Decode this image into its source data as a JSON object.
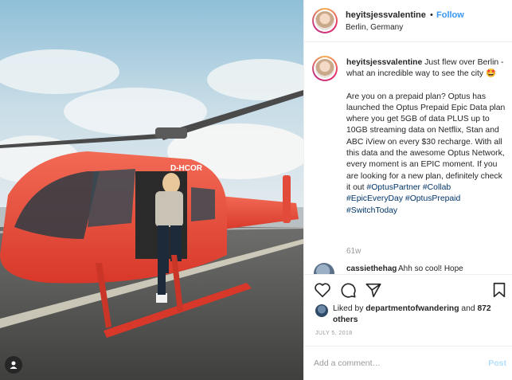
{
  "post": {
    "username": "heyitsjessvalentine",
    "dot": "•",
    "follow_label": "Follow",
    "location": "Berlin, Germany",
    "caption_intro": "Just flew over Berlin - what an incredible way to see the city 🤩",
    "caption_body": "Are you on a prepaid plan? Optus has launched the Optus Prepaid Epic Data plan where you get 5GB of data PLUS up to 10GB streaming data on Netflix, Stan and ABC iView on every $30 recharge. With all this data and the awesome Optus Network, every moment is an EPIC moment. If you are looking for a new plan, definitely check it out",
    "hashtags": [
      "#OptusPartner",
      "#Collab",
      "#EpicEveryDay",
      "#OptusPrepaid",
      "#SwitchToday"
    ],
    "time_ago": "61w",
    "helicopter_registration": "D-HCOR"
  },
  "reply": {
    "username": "cassiethehag",
    "text": "Ahh so cool! Hope"
  },
  "actions": {
    "like_icon": "heart-icon",
    "comment_icon": "comment-icon",
    "share_icon": "share-icon",
    "save_icon": "bookmark-icon"
  },
  "likes": {
    "prefix": "Liked by",
    "user": "departmentofwandering",
    "and": "and",
    "others": "872 others"
  },
  "date": "JULY 5, 2018",
  "comment_box": {
    "placeholder": "Add a comment…",
    "post_label": "Post"
  },
  "colors": {
    "link_blue": "#3897f0",
    "hashtag": "#003569",
    "helicopter_red": "#ee4b3a",
    "post_disabled": "#b2dffc"
  }
}
